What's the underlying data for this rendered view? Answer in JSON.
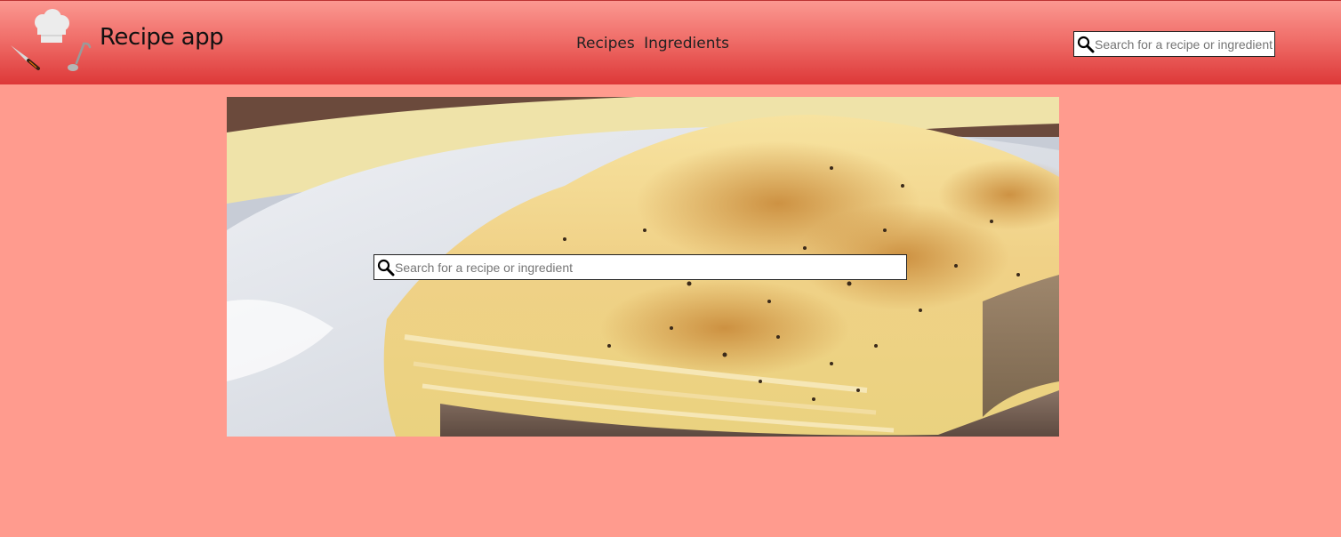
{
  "header": {
    "title": "Recipe app",
    "nav": [
      "Recipes",
      "Ingredients"
    ],
    "search": {
      "placeholder": "Search for a recipe or ingredient",
      "value": ""
    }
  },
  "hero": {
    "image": "lasagna-photo",
    "search": {
      "placeholder": "Search for a recipe or ingredient",
      "value": ""
    }
  },
  "icons": {
    "logo": [
      "chef-hat-icon",
      "knife-icon",
      "ladle-icon"
    ],
    "search": "magnifier-icon"
  },
  "colors": {
    "page_background": "#ff9b8e",
    "header_top": "#fb9891",
    "header_bottom": "#dd3838",
    "text": "#111111"
  }
}
